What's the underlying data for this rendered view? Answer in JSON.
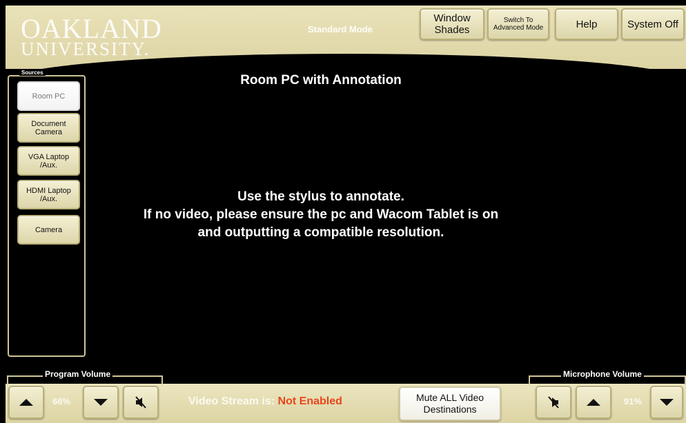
{
  "header": {
    "logo_line1": "OAKLAND",
    "logo_line2": "UNIVERSITY.",
    "mode": "Standard Mode",
    "buttons": [
      {
        "label_line1": "Window",
        "label_line2": "Shades"
      },
      {
        "label_line1": "Switch To",
        "label_line2": "Advanced Mode"
      },
      {
        "label": "Help"
      },
      {
        "label": "System Off"
      }
    ]
  },
  "sources": {
    "title": "Sources",
    "items": [
      {
        "line1": "Room PC",
        "line2": "",
        "selected": true
      },
      {
        "line1": "Document",
        "line2": "Camera",
        "selected": false
      },
      {
        "line1": "VGA Laptop",
        "line2": "/Aux.",
        "selected": false
      },
      {
        "line1": "HDMI Laptop",
        "line2": "/Aux.",
        "selected": false
      },
      {
        "line1": "Camera",
        "line2": "",
        "selected": false
      }
    ]
  },
  "main": {
    "title": "Room PC with Annotation",
    "message": [
      "Use the stylus to annotate.",
      "If no video, please ensure the pc and Wacom Tablet is on",
      "and outputting a compatible resolution."
    ]
  },
  "bottom": {
    "program_volume": {
      "label": "Program Volume",
      "value": "66%"
    },
    "microphone_volume": {
      "label": "Microphone Volume",
      "value": "91%"
    },
    "stream_label": "Video Stream is:",
    "stream_status": "Not Enabled",
    "mute_all_line1": "Mute ALL Video",
    "mute_all_line2": "Destinations"
  },
  "colors": {
    "panel": "#e4dcb2",
    "stream_status": "#e8461b"
  },
  "icons": [
    "mute-speaker-icon",
    "up-arrow-icon",
    "down-arrow-icon"
  ]
}
